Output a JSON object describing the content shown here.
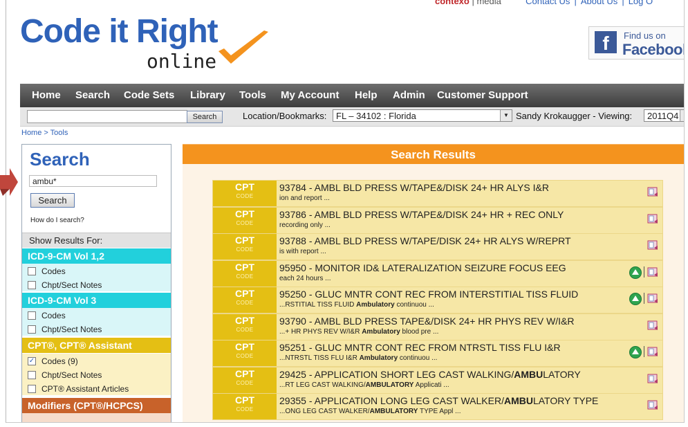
{
  "header": {
    "logo_main": "Code it Right",
    "logo_sub": "online",
    "brand": "contexo",
    "brand_media": "media",
    "links": [
      "Contact Us",
      "About Us",
      "Log O"
    ],
    "facebook_small": "Find us on",
    "facebook_big": "Facebook"
  },
  "nav": {
    "items": [
      "Home",
      "Search",
      "Code Sets",
      "Library",
      "Tools",
      "My Account",
      "Help",
      "Admin",
      "Customer Support"
    ]
  },
  "toolbar": {
    "search_button": "Search",
    "location_label": "Location/Bookmarks:",
    "location_value": "FL – 34102 : Florida",
    "user_viewing": "Sandy Krokaugger - Viewing:",
    "viewing_value": "2011Q4"
  },
  "breadcrumb": "Home > Tools",
  "left_panel": {
    "title": "Search",
    "query": "ambu*",
    "search_button": "Search",
    "help_link": "How do I search?",
    "show_results": "Show Results For:",
    "sections": [
      {
        "title": "ICD-9-CM Vol 1,2",
        "color": "#22d0dc",
        "bg": "#d9f6f8",
        "options": [
          {
            "label": "Codes",
            "checked": false
          },
          {
            "label": "Chpt/Sect Notes",
            "checked": false
          }
        ]
      },
      {
        "title": "ICD-9-CM Vol 3",
        "color": "#22d0dc",
        "bg": "#d9f6f8",
        "options": [
          {
            "label": "Codes",
            "checked": false
          },
          {
            "label": "Chpt/Sect Notes",
            "checked": false
          }
        ]
      },
      {
        "title": "CPT®, CPT® Assistant",
        "color": "#e4bf14",
        "bg": "#fbf1c4",
        "options": [
          {
            "label": "Codes (9)",
            "checked": true
          },
          {
            "label": "Chpt/Sect Notes",
            "checked": false
          },
          {
            "label": "CPT® Assistant Articles",
            "checked": false
          }
        ]
      },
      {
        "title": "Modifiers (CPT®/HCPCS)",
        "color": "#c8622a",
        "bg": "#f6dccb",
        "options": []
      }
    ]
  },
  "results": {
    "header": "Search Results",
    "type_sub": "CODE",
    "rows": [
      {
        "type": "CPT",
        "title": "93784 - AMBL BLD PRESS W/TAPE&/DISK 24+ HR ALYS I&R",
        "snippet": "ion and report ...",
        "up": false
      },
      {
        "type": "CPT",
        "title": "93786 - AMBL BLD PRESS W/TAPE&/DISK 24+ HR + REC ONLY",
        "snippet": "recording only ...",
        "up": false
      },
      {
        "type": "CPT",
        "title": "93788 - AMBL BLD PRESS W/TAPE/DISK 24+ HR ALYS W/REPRT",
        "snippet": "is with report ...",
        "up": false
      },
      {
        "type": "CPT",
        "title": "95950 - MONITOR ID& LATERALIZATION SEIZURE FOCUS EEG",
        "snippet": "each 24 hours ...",
        "up": true
      },
      {
        "type": "CPT",
        "title": "95250 - GLUC MNTR CONT REC FROM INTERSTITIAL TISS FLUID",
        "snippet": "...RSTITIAL TISS FLUID Ambulatory continuou ...",
        "up": true
      },
      {
        "type": "CPT",
        "title": "93790 - AMBL BLD PRESS TAPE&/DISK 24+ HR PHYS REV W/I&R",
        "snippet": "...+ HR PHYS REV W/I&R Ambulatory blood pre ...",
        "up": false
      },
      {
        "type": "CPT",
        "title": "95251 - GLUC MNTR CONT REC FROM NTRSTL TISS FLU I&R",
        "snippet": "...NTRSTL TISS FLU I&R Ambulatory continuou ...",
        "up": true
      },
      {
        "type": "CPT",
        "title": "29425 - APPLICATION SHORT LEG CAST WALKING/AMBULATORY",
        "snippet": "...RT LEG CAST WALKING/AMBULATORY Applicati ...",
        "up": false
      },
      {
        "type": "CPT",
        "title": "29355 - APPLICATION LONG LEG CAST WALKER/AMBULATORY TYPE",
        "snippet": "...ONG LEG CAST WALKER/AMBULATORY TYPE Appl ...",
        "up": false
      }
    ]
  }
}
